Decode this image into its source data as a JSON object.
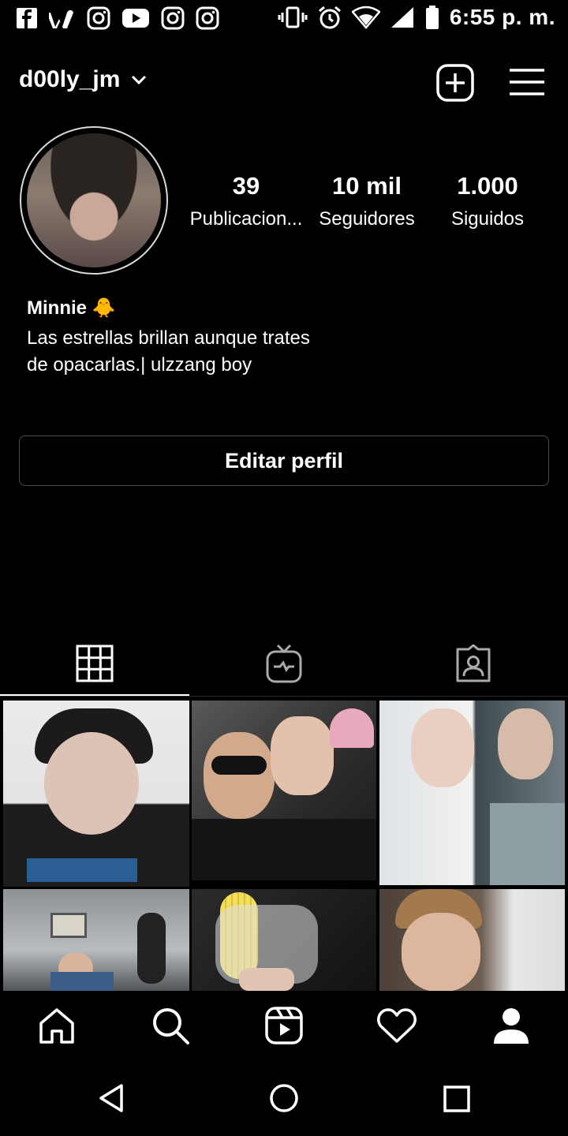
{
  "status_bar": {
    "time": "6:55 p. m.",
    "left_icons": [
      "facebook-icon",
      "wattpad-icon",
      "instagram-icon",
      "youtube-icon",
      "instagram-icon",
      "instagram-icon"
    ],
    "right_icons": [
      "vibrate-icon",
      "alarm-icon",
      "wifi-icon",
      "signal-icon",
      "battery-icon"
    ]
  },
  "header": {
    "username": "d00ly_jm",
    "icons": [
      "chevron-down-icon",
      "add-post-icon",
      "menu-icon"
    ]
  },
  "profile": {
    "stats": [
      {
        "value": "39",
        "label": "Publicacion..."
      },
      {
        "value": "10 mil",
        "label": "Seguidores"
      },
      {
        "value": "1.000",
        "label": "Siguidos"
      }
    ],
    "name": "Minnie 🐥",
    "bio": "Las estrellas brillan aunque trates de opacarlas.| ulzzang boy",
    "edit_label": "Editar perfil"
  },
  "tabs": [
    {
      "icon": "grid-icon",
      "active": true
    },
    {
      "icon": "igtv-icon",
      "active": false
    },
    {
      "icon": "tagged-icon",
      "active": false
    }
  ],
  "grid": [
    {
      "name": "post-1",
      "colors": [
        "#e8e6e6",
        "#d8c4b8",
        "#1c1c1c"
      ]
    },
    {
      "name": "post-2",
      "colors": [
        "#4a4848",
        "#1a1a1a",
        "#d9a7b2"
      ]
    },
    {
      "name": "post-3",
      "colors": [
        "#d8dde0",
        "#eeeeee",
        "#6f7a7e"
      ]
    },
    {
      "name": "post-4",
      "colors": [
        "#8a8e92",
        "#3a5d8a",
        "#1c1c1c"
      ]
    },
    {
      "name": "post-5",
      "colors": [
        "#1a1a1a",
        "#e9d24a",
        "#cfd2d4"
      ]
    },
    {
      "name": "post-6",
      "colors": [
        "#7a6b5e",
        "#d9b49a",
        "#e8e8e8"
      ]
    }
  ],
  "bottom_nav": [
    "home-icon",
    "search-icon",
    "reels-icon",
    "heart-icon",
    "profile-icon"
  ],
  "system_nav": [
    "back-icon",
    "home-circle-icon",
    "recents-icon"
  ]
}
